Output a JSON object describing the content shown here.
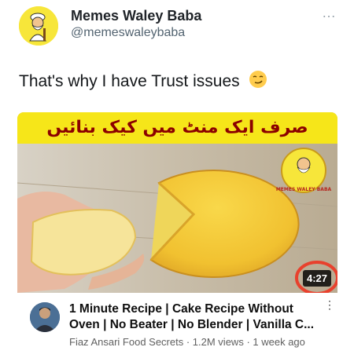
{
  "tweet": {
    "display_name": "Memes Waley Baba",
    "handle": "@memeswaleybaba",
    "more_icon": "…",
    "text": "That's why I have Trust issues",
    "emoji": "smirk-emoji"
  },
  "thumbnail": {
    "banner_text": "صرف ایک منٹ میں کیک بنائیں",
    "duration": "4:27",
    "watermark_text": "MEMES WALEY BABA",
    "highlight_color": "#e8412d"
  },
  "video": {
    "title_line1": "1 Minute Recipe | Cake Recipe Without",
    "title_line2": "Oven | No Beater | No Blender | Vanilla C...",
    "channel": "Fiaz Ansari Food Secrets",
    "views": "1.2M views",
    "age": "1 week ago",
    "separator": " · "
  }
}
